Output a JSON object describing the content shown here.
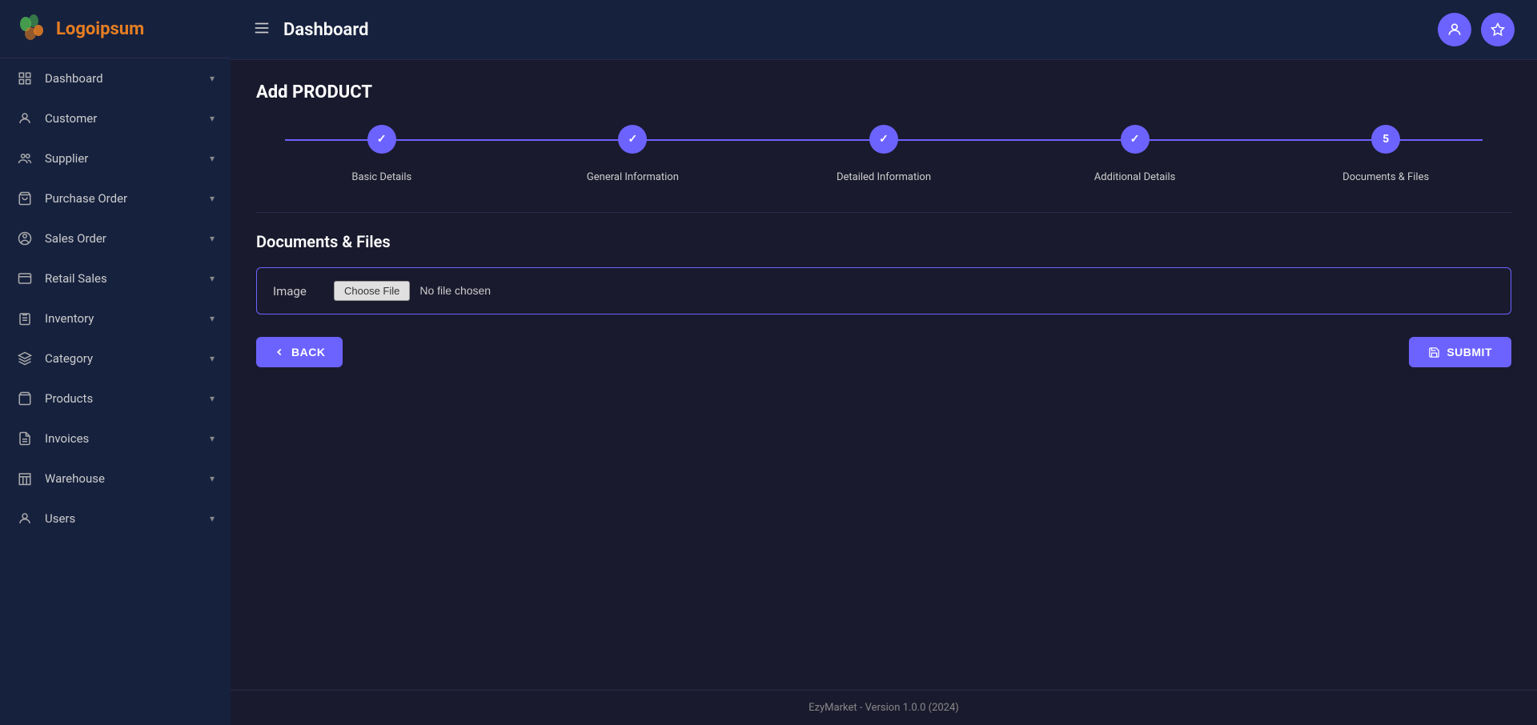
{
  "app": {
    "name": "Logoipsum",
    "version_text": "EzyMarket - Version 1.0.0 (2024)"
  },
  "topbar": {
    "title": "Dashboard"
  },
  "sidebar": {
    "items": [
      {
        "label": "Dashboard",
        "icon": "grid"
      },
      {
        "label": "Customer",
        "icon": "person"
      },
      {
        "label": "Supplier",
        "icon": "people"
      },
      {
        "label": "Purchase Order",
        "icon": "cart"
      },
      {
        "label": "Sales Order",
        "icon": "account"
      },
      {
        "label": "Retail Sales",
        "icon": "terminal"
      },
      {
        "label": "Inventory",
        "icon": "clipboard"
      },
      {
        "label": "Category",
        "icon": "layers"
      },
      {
        "label": "Products",
        "icon": "bag"
      },
      {
        "label": "Invoices",
        "icon": "file"
      },
      {
        "label": "Warehouse",
        "icon": "building"
      },
      {
        "label": "Users",
        "icon": "account"
      }
    ]
  },
  "page": {
    "title": "Add PRODUCT",
    "stepper": {
      "steps": [
        {
          "label": "Basic Details",
          "state": "done"
        },
        {
          "label": "General Information",
          "state": "done"
        },
        {
          "label": "Detailed Information",
          "state": "done"
        },
        {
          "label": "Additional Details",
          "state": "done"
        },
        {
          "label": "Documents & Files",
          "state": "active",
          "number": "5"
        }
      ]
    },
    "section_title": "Documents & Files",
    "file_input_label": "Image",
    "file_placeholder": "No file chosen",
    "back_button": "BACK",
    "submit_button": "SUBMIT"
  }
}
